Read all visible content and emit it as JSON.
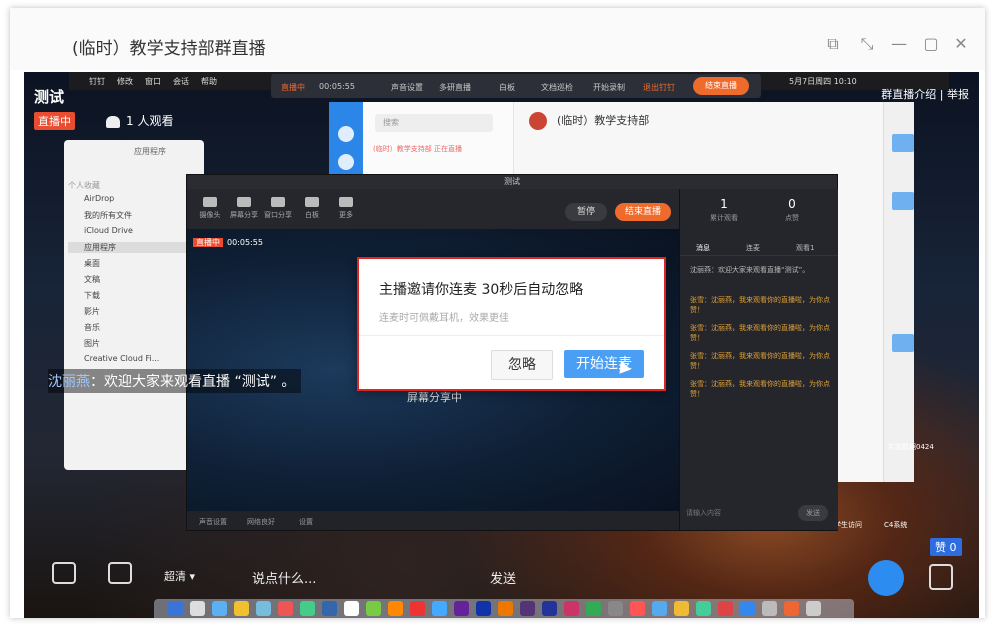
{
  "window": {
    "title": "(临时）教学支持部群直播",
    "buttons": [
      "⧉",
      "⤡",
      "—",
      "▢",
      "✕"
    ]
  },
  "live": {
    "title": "测试",
    "badge": "直播中",
    "viewers": "1 人观看",
    "top_right": "群直播介绍 | 举报"
  },
  "mac_menu": [
    "钉钉",
    "修改",
    "窗口",
    "会话",
    "帮助"
  ],
  "mac_clock": "5月7日周四 10:10",
  "recbar": {
    "timer": "00:05:55",
    "items": [
      "声音设置",
      "多研直播",
      "白板",
      "文档巡检",
      "开始录制",
      "退出钉钉"
    ],
    "end_label": "结束直播"
  },
  "finder": {
    "title": "应用程序",
    "items": [
      "个人收藏",
      "AirDrop",
      "我的所有文件",
      "iCloud Drive",
      "应用程序",
      "桌面",
      "文稿",
      "下载",
      "影片",
      "音乐",
      "图片",
      "Creative Cloud Fi..."
    ]
  },
  "dingtalk": {
    "search_placeholder": "搜索",
    "chat_title": "(临时）教学支持部",
    "list_item": "(临时）教学支持部 正在直播"
  },
  "panel": {
    "window_title": "测试",
    "tools": [
      "摄像头",
      "屏幕分享",
      "窗口分享",
      "白板",
      "更多"
    ],
    "pause": "暂停",
    "end": "结束直播",
    "rec_label": "直播中",
    "rec_timer": "00:05:55",
    "sharing": "屏幕分享中",
    "bottom": [
      "声音设置",
      "网络良好",
      "设置"
    ],
    "stats": [
      {
        "value": "1",
        "label": "累计观看"
      },
      {
        "value": "0",
        "label": "点赞"
      }
    ],
    "side_tabs": [
      "消息",
      "连麦",
      "观看1"
    ],
    "messages": [
      "沈丽燕：欢迎大家来观看直播“测试”。",
      "张雪：沈丽燕，我来观看你的直播啦，为你点赞！",
      "张雪：沈丽燕，我来观看你的直播啦，为你点赞！",
      "张雪：沈丽燕，我来观看你的直播啦，为你点赞！",
      "张雪：沈丽燕，我来观看你的直播啦，为你点赞！"
    ],
    "input_placeholder": "请输入内容",
    "send": "发送"
  },
  "dialog": {
    "title": "主播邀请你连麦 30秒后自动忽略",
    "subtitle": "连麦时可佩戴耳机，效果更佳",
    "ignore": "忽略",
    "start": "开始连麦"
  },
  "chat_overlay": {
    "name": "沈丽燕",
    "text": "：欢迎大家来观看直播 “测试” 。"
  },
  "bottom_bar": {
    "quality": "超清 ▾",
    "input_placeholder": "说点什么...",
    "send": "发送",
    "like_count": "赞 0"
  },
  "desktop_icons": [
    "实验数据0424",
    "学生访问",
    "C4系统"
  ],
  "colors": {
    "accent": "#2d8cf0",
    "live_red": "#e94c2f",
    "end_orange": "#ef6b2c",
    "dialog_border": "#e02424",
    "dialog_button": "#4a9ff5"
  }
}
